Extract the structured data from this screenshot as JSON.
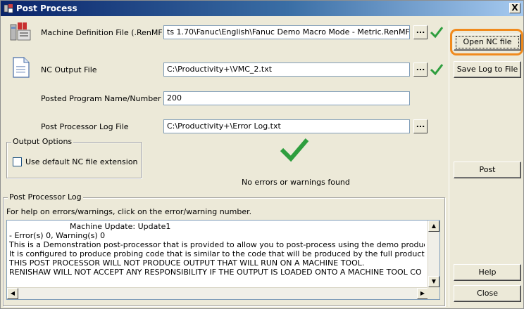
{
  "window": {
    "title": "Post Process",
    "close_glyph": "X"
  },
  "fields": {
    "machine_def": {
      "label": "Machine Definition File (.RenMF)",
      "value": "ts 1.70\\Fanuc\\English\\Fanuc Demo Macro Mode - Metric.RenMF"
    },
    "nc_output": {
      "label": "NC Output File",
      "value": "C:\\Productivity+\\VMC_2.txt"
    },
    "program_name": {
      "label": "Posted Program Name/Number",
      "value": "200"
    },
    "log_file": {
      "label": "Post Processor Log File",
      "value": "C:\\Productivity+\\Error Log.txt"
    }
  },
  "browse_label": "...",
  "output_options": {
    "legend": "Output Options",
    "use_default_ext": {
      "label": "Use default NC file extension",
      "checked": false
    }
  },
  "status": {
    "message": "No errors or warnings found",
    "check_color": "#2e9e3e"
  },
  "log": {
    "legend": "Post Processor Log",
    "help_text": "For help on errors/warnings, click on the error/warning number.",
    "lines": [
      "Machine Update: Update1",
      " - Error(s) 0, Warning(s) 0",
      "This is a Demonstration post-processor that is provided to allow you to post-process using the demo product.",
      "It is configured to produce probing code that is similar to the code that will be produced by the full product.",
      "THIS POST PROCESSOR WILL NOT PRODUCE OUTPUT THAT WILL RUN ON A MACHINE TOOL.",
      "RENISHAW WILL NOT ACCEPT ANY RESPONSIBILITY IF THE OUTPUT IS LOADED ONTO A MACHINE TOOL CO"
    ]
  },
  "buttons": {
    "open_nc": "Open NC file",
    "save_log": "Save Log to File",
    "post": "Post",
    "help": "Help",
    "close": "Close"
  },
  "colors": {
    "highlight_ring": "#f08a1c",
    "title_bar": "#0a246a"
  }
}
